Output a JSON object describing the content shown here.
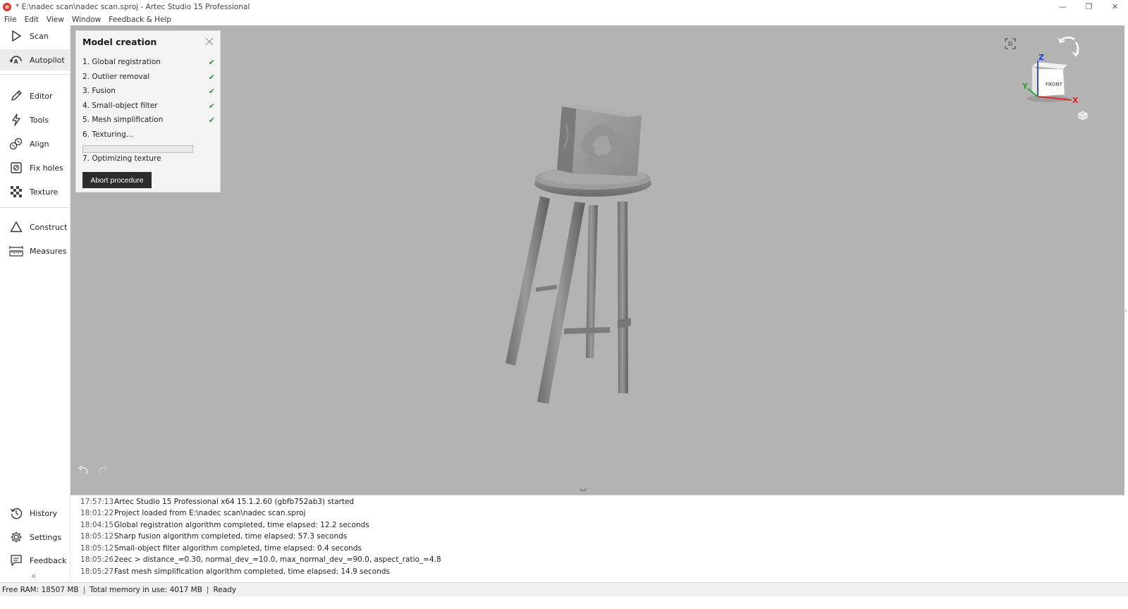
{
  "window": {
    "title": "* E:\\nadec scan\\nadec scan.sproj - Artec Studio 15 Professional",
    "minimize": "—",
    "maximize": "❐",
    "close": "✕"
  },
  "menu": [
    "File",
    "Edit",
    "Window",
    "View",
    "Feedback & Help"
  ],
  "sidebar": {
    "top": [
      {
        "label": "Scan",
        "icon": "play-triangle-icon"
      },
      {
        "label": "Autopilot",
        "icon": "autopilot-icon"
      }
    ],
    "middle": [
      {
        "label": "Editor",
        "icon": "pencil-icon"
      },
      {
        "label": "Tools",
        "icon": "lightning-icon"
      },
      {
        "label": "Align",
        "icon": "align-icon"
      },
      {
        "label": "Fix holes",
        "icon": "fix-holes-icon"
      },
      {
        "label": "Texture",
        "icon": "checker-icon"
      }
    ],
    "tools2": [
      {
        "label": "Construct",
        "icon": "triangle-icon"
      },
      {
        "label": "Measures",
        "icon": "ruler-icon"
      }
    ],
    "bottom": [
      {
        "label": "History",
        "icon": "history-icon"
      },
      {
        "label": "Settings",
        "icon": "gear-icon"
      },
      {
        "label": "Feedback",
        "icon": "chat-icon"
      }
    ],
    "collapse": "«"
  },
  "model_creation": {
    "title": "Model creation",
    "steps": [
      {
        "label": "1. Global registration",
        "done": "✔"
      },
      {
        "label": "2. Outlier removal",
        "done": "✔"
      },
      {
        "label": "3. Fusion",
        "done": "✔"
      },
      {
        "label": "4. Small-object filter",
        "done": "✔"
      },
      {
        "label": "5. Mesh simplification",
        "done": "✔"
      },
      {
        "label": "6. Texturing...",
        "done": ""
      },
      {
        "label": "7. Optimizing texture",
        "done": ""
      }
    ],
    "progress": 0,
    "abort_label": "Abort procedure"
  },
  "view_cube": {
    "face_label": "FRONT",
    "axis_x": "X",
    "axis_y": "Y",
    "axis_z": "Z"
  },
  "log_toggle": "︾",
  "log": [
    {
      "time": "17:57:13",
      "message": "Artec Studio 15 Professional x64 15.1.2.60 (gbfb752ab3) started"
    },
    {
      "time": "18:01:22",
      "message": "Project loaded from E:\\nadec scan\\nadec scan.sproj"
    },
    {
      "time": "18:04:15",
      "message": "Global registration algorithm completed, time elapsed: 12.2 seconds"
    },
    {
      "time": "18:05:12",
      "message": "Sharp fusion algorithm completed, time elapsed: 57.3 seconds"
    },
    {
      "time": "18:05:12",
      "message": "Small-object filter algorithm completed, time elapsed: 0.4 seconds"
    },
    {
      "time": "18:05:26",
      "message": "2eec > distance_=0.30, normal_dev_=10.0, max_normal_dev_=90.0, aspect_ratio_=4.8"
    },
    {
      "time": "18:05:27",
      "message": "Fast mesh simplification algorithm completed, time elapsed: 14.9 seconds"
    }
  ],
  "status": {
    "free_ram": "Free RAM: 18507 MB",
    "total_memory": "Total memory in use: 4017 MB",
    "state": "Ready",
    "separator": "|"
  },
  "colors": {
    "viewport_bg": "#b3b3b3",
    "check_green": "#2e9a3e",
    "abort_bg": "#2c2c2c",
    "axis_x": "#e0201a",
    "axis_y": "#28a428",
    "axis_z": "#1f3fd0"
  }
}
